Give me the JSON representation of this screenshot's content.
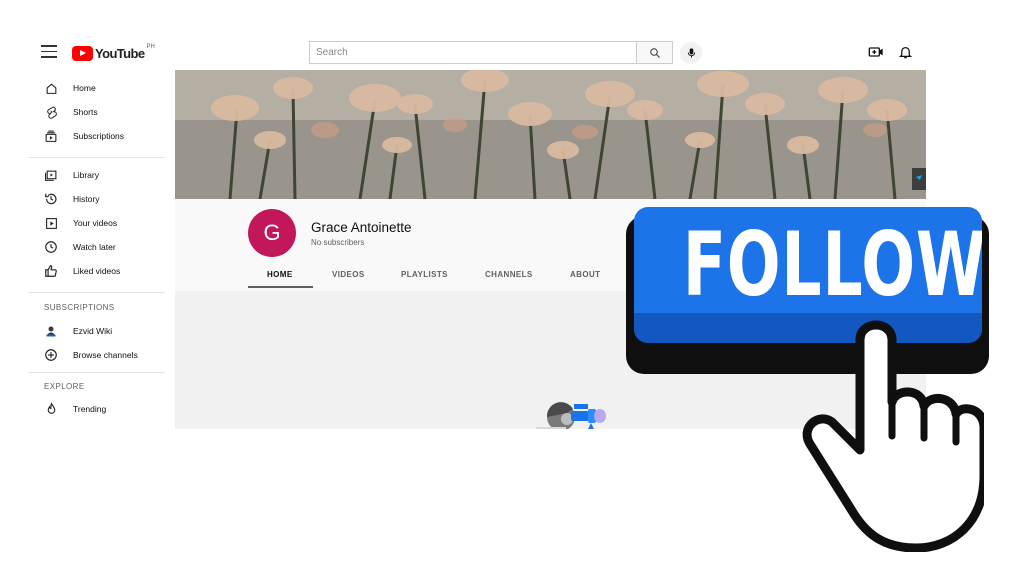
{
  "masthead": {
    "logo_text": "YouTube",
    "country_code": "PH",
    "search_placeholder": "Search"
  },
  "sidebar": {
    "main": [
      {
        "label": "Home",
        "icon": "home-icon"
      },
      {
        "label": "Shorts",
        "icon": "shorts-icon"
      },
      {
        "label": "Subscriptions",
        "icon": "subscriptions-icon"
      }
    ],
    "library": [
      {
        "label": "Library",
        "icon": "library-icon"
      },
      {
        "label": "History",
        "icon": "history-icon"
      },
      {
        "label": "Your videos",
        "icon": "your-videos-icon"
      },
      {
        "label": "Watch later",
        "icon": "watch-later-icon"
      },
      {
        "label": "Liked videos",
        "icon": "liked-videos-icon"
      }
    ],
    "subscriptions_header": "SUBSCRIPTIONS",
    "subscriptions": [
      {
        "label": "Ezvid Wiki",
        "icon": "ezvid-wiki-avatar"
      },
      {
        "label": "Browse channels",
        "icon": "browse-channels-icon"
      }
    ],
    "explore_header": "EXPLORE",
    "explore": [
      {
        "label": "Trending",
        "icon": "trending-icon"
      }
    ]
  },
  "channel": {
    "avatar_letter": "G",
    "avatar_color": "#c2185b",
    "name": "Grace Antoinette",
    "subscribers": "No subscribers",
    "tabs": [
      "HOME",
      "VIDEOS",
      "PLAYLISTS",
      "CHANNELS",
      "ABOUT"
    ],
    "active_tab": "HOME"
  },
  "overlay": {
    "follow_label": "FOLLOW",
    "button_color": "#1d73e8"
  },
  "colors": {
    "brand_red": "#ff0000",
    "accent_blue": "#1d73e8"
  }
}
